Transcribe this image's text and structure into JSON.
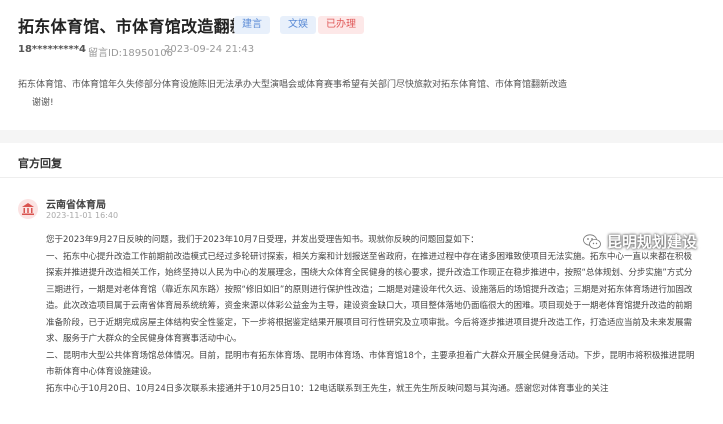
{
  "header": {
    "title": "拓东体育馆、市体育馆改造翻新",
    "tags": [
      "建言",
      "文娱",
      "已办理"
    ],
    "user": "18*********4",
    "message_id": "留言ID:18950106",
    "time": "2023-09-24 21:43"
  },
  "message": {
    "line1": "拓东体育馆、市体育馆年久失修部分体育设施陈旧无法承办大型演唱会或体育赛事希望有关部门尽快旅款对拓东体育馆、市体育馆翻新改造",
    "line2": "谢谢!"
  },
  "reply": {
    "section_title": "官方回复",
    "org": "云南省体育局",
    "time": "2023-11-01 16:40",
    "paragraphs": [
      "您于2023年9月27日反映的问题，我们于2023年10月7日受理，并发出受理告知书。现就你反映的问题回复如下：",
      "一、拓东中心提升改造工作前期前改造模式已经过多轮研讨探索，相关方案和计划报送至省政府，在推进过程中存在诸多困难致使项目无法实施。拓东中心一直以来都在积极探索并推进提升改造相关工作，始终坚持以人民为中心的发展理念，围绕大众体育全民健身的核心要求，提升改造工作现正在稳步推进中，按照“总体规划、分步实施”方式分三期进行，一期是对老体育馆（靠近东风东路）按照“修旧如旧”的原则进行保护性改造；二期是对建设年代久远、设施落后的场馆提升改造；三期是对拓东体育场进行加固改造。此次改造项目属于云南省体育局系统统筹，资金来源以体彩公益金为主导，建设资金缺口大，项目整体落地仍面临很大的困难。项目现处于一期老体育馆提升改造的前期准备阶段，已于近期完成房屋主体结构安全性鉴定，下一步将根据鉴定结果开展项目可行性研究及立项审批。今后将逐步推进项目提升改造工作，打造适应当前及未来发展需求、服务于广大群众的全民健身体育赛事活动中心。",
      "二、昆明市大型公共体育场馆总体情况。目前，昆明市有拓东体育场、昆明市体育场、市体育馆18个，主要承担着广大群众开展全民健身活动。下步，昆明市将积极推进昆明市新体育中心体育设施建设。",
      "拓东中心于10月20日、10月24日多次联系未接通并于10月25日10：12电话联系到王先生，就王先生所反映问题与其沟通。感谢您对体育事业的关注"
    ]
  },
  "watermark": {
    "text": "昆明规划建设",
    "icon": "wechat-icon"
  }
}
